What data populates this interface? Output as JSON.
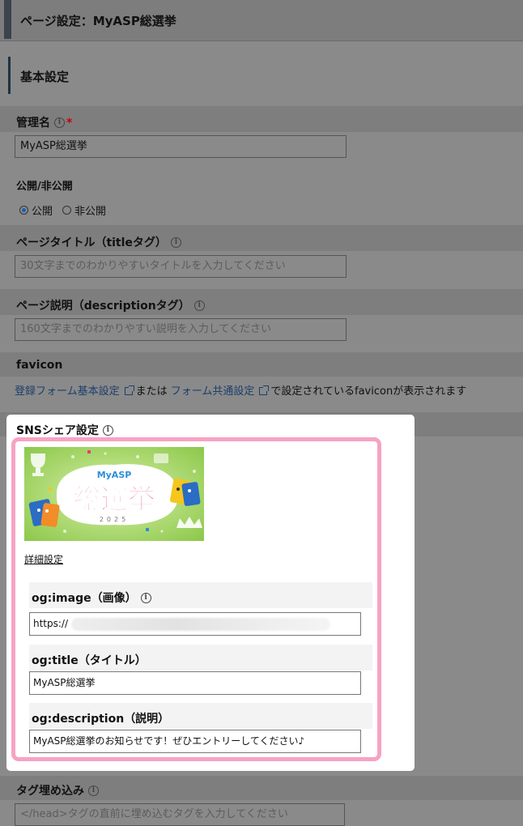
{
  "header": {
    "title": "ページ設定：MyASP総選挙"
  },
  "section": {
    "title": "基本設定"
  },
  "fields": {
    "admin_name": {
      "label": "管理名",
      "required": "*",
      "value": "MyASP総選挙"
    },
    "visibility": {
      "label": "公開/非公開",
      "options": [
        "公開",
        "非公開"
      ],
      "selected": "公開"
    },
    "page_title": {
      "label": "ページタイトル（titleタグ）",
      "placeholder": "30文字までのわかりやすいタイトルを入力してください"
    },
    "page_description": {
      "label": "ページ説明（descriptionタグ）",
      "placeholder": "160文字までのわかりやすい説明を入力してください"
    },
    "favicon": {
      "label": "favicon",
      "link1": "登録フォーム基本設定",
      "middle": "または",
      "link2": "フォーム共通設定",
      "suffix": "で設定されているfaviconが表示されます"
    },
    "tag_embed": {
      "label": "タグ埋め込み",
      "placeholder": "</head>タグの直前に埋め込むタグを入力してください"
    }
  },
  "sns": {
    "title": "SNSシェア設定",
    "image_alt_text": {
      "top": "MyASP",
      "main": "総選挙",
      "year": "2025"
    },
    "detail_link": "詳細設定",
    "og_image": {
      "label": "og:image（画像）",
      "value": "https://"
    },
    "og_title": {
      "label": "og:title（タイトル）",
      "value": "MyASP総選挙"
    },
    "og_description": {
      "label": "og:description（説明）",
      "value": "MyASP総選挙のお知らせです！ぜひエントリーしてください♪"
    }
  },
  "icons": {
    "info": "info-icon",
    "external": "external-link-icon"
  },
  "colors": {
    "overlay_bg": "#8a8a8a",
    "highlight_border": "#f7a3c3",
    "link": "#1b3f6b",
    "radio_checked": "#1d5db3",
    "required": "#cc0000"
  }
}
